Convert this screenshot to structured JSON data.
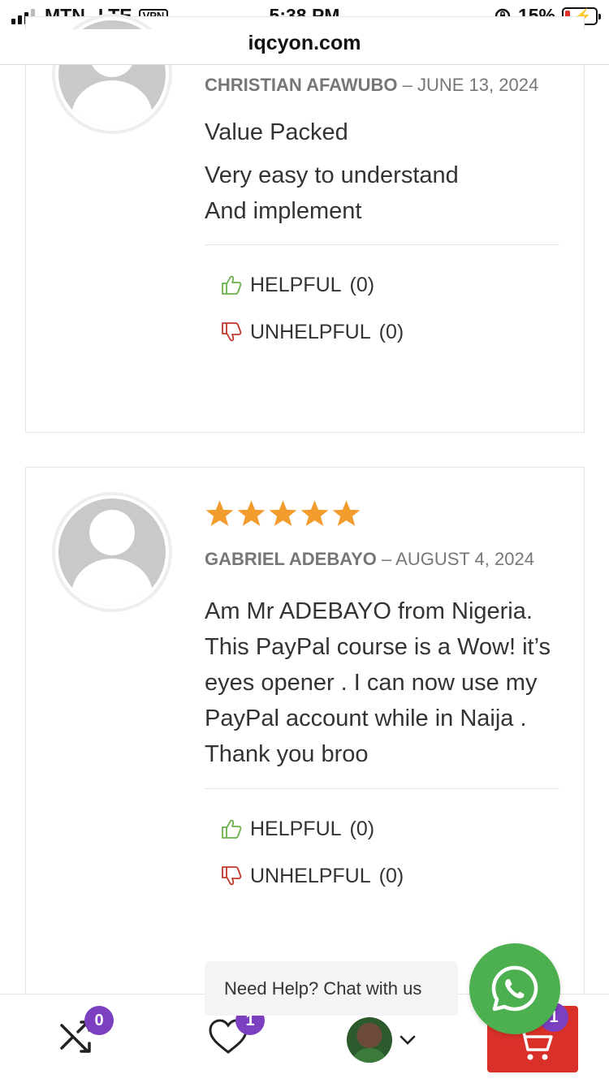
{
  "status_bar": {
    "carrier": "MTN",
    "network": "LTE",
    "vpn": "VPN",
    "time": "5:38 PM",
    "battery": "15%"
  },
  "url": "iqcyon.com",
  "reviews": [
    {
      "author": "CHRISTIAN AFAWUBO",
      "date": "– JUNE 13, 2024",
      "title": "Value Packed",
      "text_lines": [
        "Very easy to understand",
        "And implement"
      ],
      "helpful_label": "HELPFUL",
      "helpful_count": "(0)",
      "unhelpful_label": "UNHELPFUL",
      "unhelpful_count": "(0)"
    },
    {
      "rating": 5,
      "author": "GABRIEL ADEBAYO",
      "date": "– AUGUST 4, 2024",
      "text": "Am Mr ADEBAYO from Nigeria. This PayPal course is a Wow! it’s eyes opener . I can now use my PayPal account while in Naija . Thank you broo",
      "helpful_label": "HELPFUL",
      "helpful_count": "(0)",
      "unhelpful_label": "UNHELPFUL",
      "unhelpful_count": "(0)"
    }
  ],
  "chat": {
    "bubble_text": "Need Help? Chat with us",
    "icon": "whatsapp-icon"
  },
  "bottom_nav": {
    "compare_count": "0",
    "wishlist_count": "1",
    "cart_count": "1"
  },
  "colors": {
    "star": "#f39c2e",
    "helpful": "#6ab04c",
    "unhelpful": "#c0392b",
    "badge": "#7b3fbf",
    "cart": "#d9312a",
    "whatsapp": "#4caf50"
  }
}
